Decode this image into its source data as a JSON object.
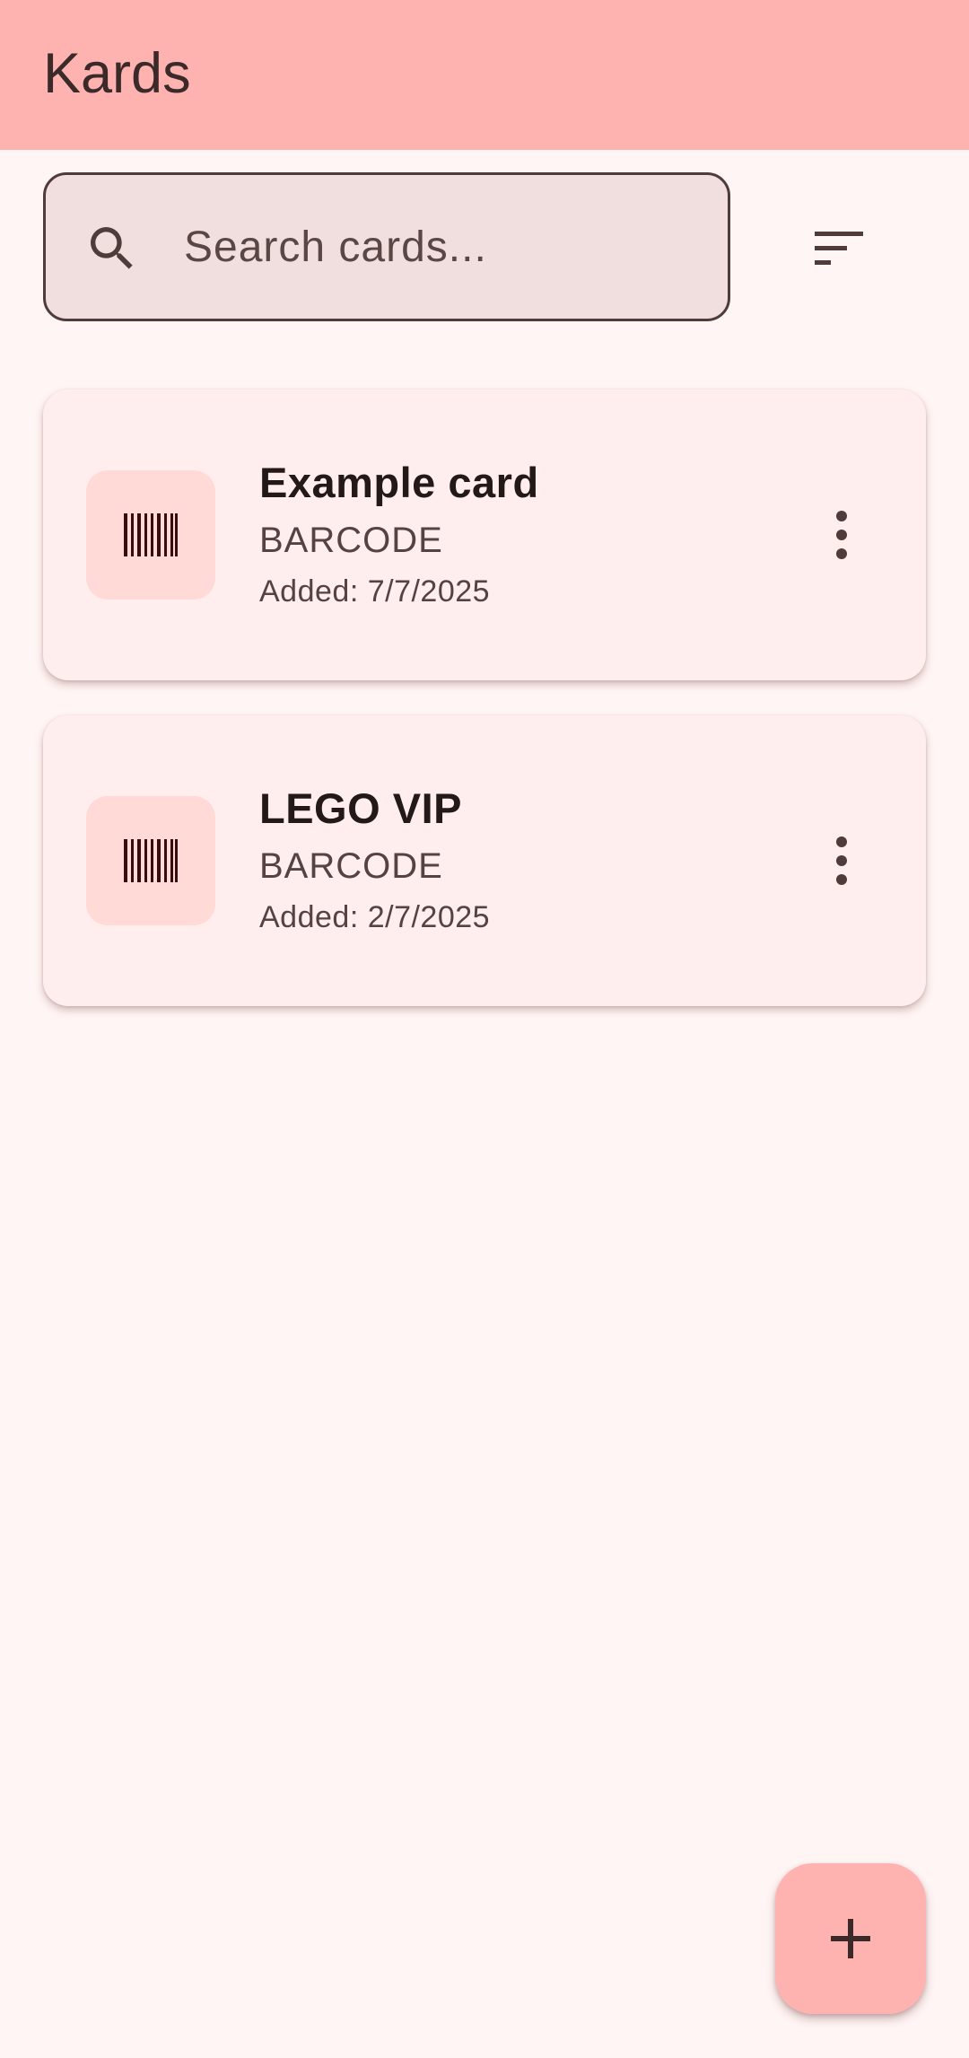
{
  "app": {
    "title": "Kards"
  },
  "search": {
    "placeholder": "Search cards...",
    "value": "",
    "icon": "search-icon"
  },
  "toolbar": {
    "sort_icon": "sort-icon"
  },
  "cards": [
    {
      "title": "Example card",
      "type": "BARCODE",
      "added": "Added: 7/7/2025",
      "icon": "barcode-icon"
    },
    {
      "title": "LEGO VIP",
      "type": "BARCODE",
      "added": "Added: 2/7/2025",
      "icon": "barcode-icon"
    }
  ],
  "fab": {
    "icon": "add-icon"
  },
  "colors": {
    "app_bar": "#ffb3b0",
    "background": "#fff5f4",
    "card": "#ffeeed",
    "icon_container": "#ffdad7",
    "search_field": "#f1dfdf",
    "text_primary": "#231918",
    "text_secondary": "#534342"
  }
}
